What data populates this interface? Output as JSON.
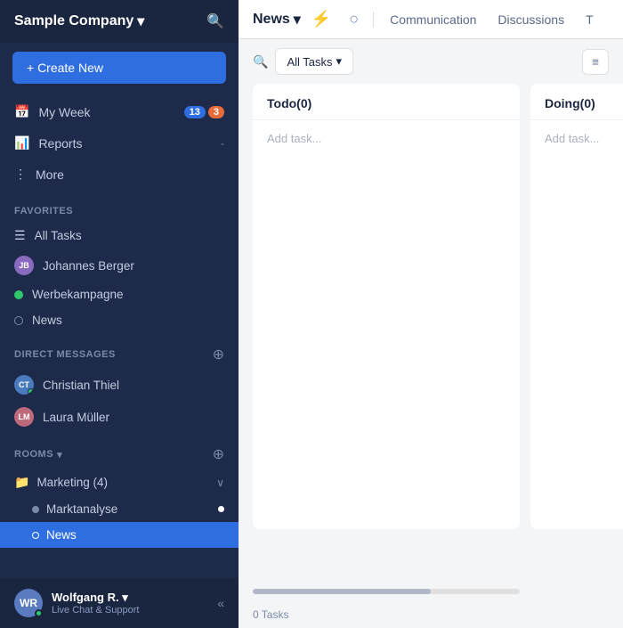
{
  "sidebar": {
    "company_name": "Sample Company",
    "company_chevron": "▾",
    "search_label": "Search",
    "create_new_label": "+ Create New",
    "my_week_label": "My Week",
    "badge_blue": "13",
    "badge_orange": "3",
    "reports_label": "Reports",
    "reports_arrow": "-",
    "more_label": "More",
    "favorites_label": "Favorites",
    "all_tasks_label": "All Tasks",
    "johannes_label": "Johannes Berger",
    "werbekampagne_label": "Werbekampagne",
    "news_fav_label": "News",
    "dm_label": "Direct Messages",
    "christian_label": "Christian Thiel",
    "laura_label": "Laura Müller",
    "rooms_label": "Rooms",
    "rooms_chevron": "▾",
    "marketing_label": "Marketing (4)",
    "marktanalyse_label": "Marktanalyse",
    "news_room_label": "News",
    "footer_name": "Wolfgang R. ▾",
    "footer_status": "Live Chat & Support",
    "collapse_label": "«"
  },
  "topnav": {
    "title": "News",
    "title_chevron": "▾",
    "pulse_icon": "⚡",
    "circle_icon": "○",
    "communication_label": "Communication",
    "discussions_label": "Discussions",
    "t_label": "T"
  },
  "main": {
    "all_tasks_label": "All Tasks",
    "all_tasks_chevron": "▾",
    "filter_icon": "≡",
    "todo_header": "Todo(0)",
    "doing_header": "Doing(0)",
    "add_task_placeholder": "Add task...",
    "tasks_count": "0 Tasks"
  }
}
